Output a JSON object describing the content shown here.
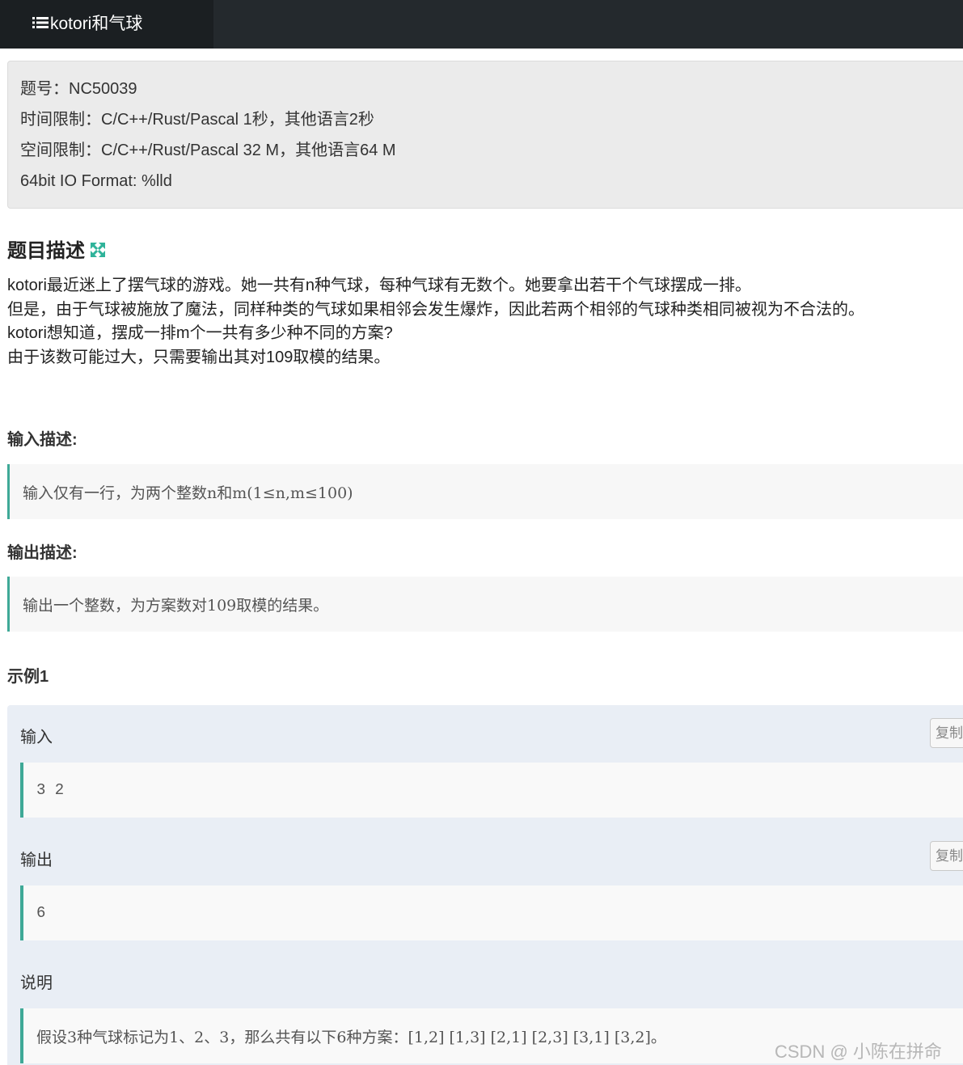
{
  "header": {
    "title": "kotori和气球",
    "icon": "list-icon"
  },
  "info": {
    "problem_id": "题号：NC50039",
    "time_limit": "时间限制：C/C++/Rust/Pascal 1秒，其他语言2秒",
    "memory_limit": "空间限制：C/C++/Rust/Pascal 32 M，其他语言64 M",
    "io_format": "64bit IO Format: %lld"
  },
  "description": {
    "heading": "题目描述",
    "expand_icon": "expand-icon",
    "lines": [
      "kotori最近迷上了摆气球的游戏。她一共有n种气球，每种气球有无数个。她要拿出若干个气球摆成一排。",
      "但是，由于气球被施放了魔法，同样种类的气球如果相邻会发生爆炸，因此若两个相邻的气球种类相同被视为不合法的。",
      "kotori想知道，摆成一排m个一共有多少种不同的方案?",
      "由于该数可能过大，只需要输出其对109取模的结果。"
    ]
  },
  "input_desc": {
    "heading": "输入描述:",
    "text": "输入仅有一行，为两个整数n和m(1≤n,m≤100)"
  },
  "output_desc": {
    "heading": "输出描述:",
    "text": "输出一个整数，为方案数对109取模的结果。"
  },
  "example": {
    "heading": "示例1",
    "input_label": "输入",
    "input_value": "3 2",
    "output_label": "输出",
    "output_value": "6",
    "copy_label": "复制",
    "note_label": "说明",
    "note_text": "假设3种气球标记为1、2、3，那么共有以下6种方案：[1,2] [1,3] [2,1] [2,3] [3,1] [3,2]。"
  },
  "watermark": "CSDN @ 小陈在拼命",
  "colors": {
    "accent": "#3fa997",
    "topbar": "#24292d",
    "info_bg": "#ebebeb",
    "example_bg": "#e9eef5"
  }
}
